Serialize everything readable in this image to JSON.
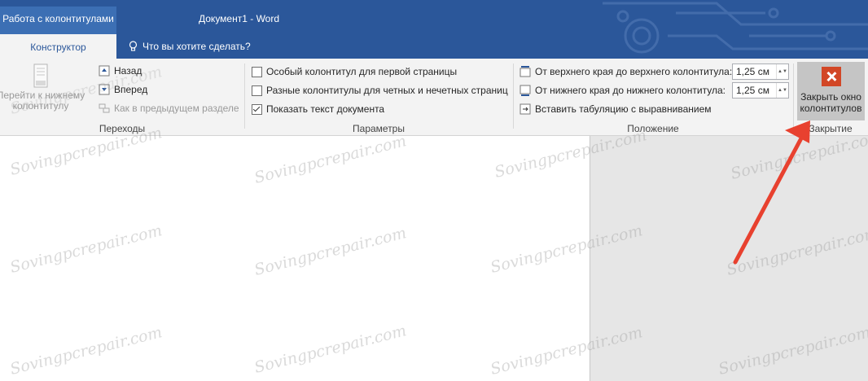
{
  "titlebar": {
    "context_tab": "Работа с колонтитулами",
    "doc_title": "Документ1 - Word",
    "active_tab": "Конструктор",
    "tell_me": "Что вы хотите сделать?"
  },
  "ribbon": {
    "nav": {
      "goto_footer_line1": "Перейти к нижнему",
      "goto_footer_line2": "колонтитулу",
      "back": "Назад",
      "forward": "Вперед",
      "link_previous": "Как в предыдущем разделе",
      "label": "Переходы"
    },
    "options": {
      "first_page": "Особый колонтитул для первой страницы",
      "odd_even": "Разные колонтитулы для четных и нечетных страниц",
      "show_text": "Показать текст документа",
      "label": "Параметры"
    },
    "position": {
      "header_from_top": "От верхнего края до верхнего колонтитула:",
      "header_value": "1,25 см",
      "footer_from_bottom": "От нижнего края до нижнего колонтитула:",
      "footer_value": "1,25 см",
      "insert_tab": "Вставить табуляцию с выравниванием",
      "label": "Положение"
    },
    "close": {
      "line1": "Закрыть окно",
      "line2": "колонтитулов",
      "label": "Закрытие"
    }
  },
  "watermark": "Sovingpcrepair.com",
  "colors": {
    "titlebar": "#2b579a",
    "close_icon": "#d24726",
    "annotation_arrow": "#e8412f"
  }
}
